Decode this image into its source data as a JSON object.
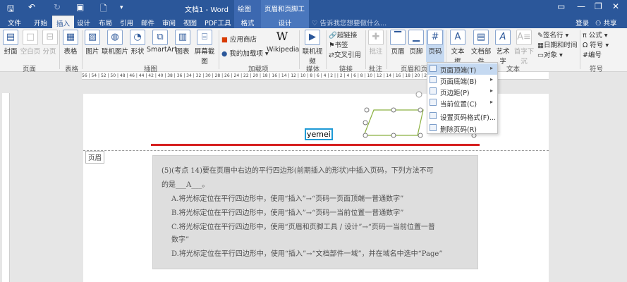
{
  "app": {
    "title": "文档1 - Word",
    "context_groups": [
      "绘图工具",
      "页眉和页脚工具"
    ],
    "login": "登录",
    "share": "共享"
  },
  "tabs": [
    "文件",
    "开始",
    "插入",
    "设计",
    "布局",
    "引用",
    "邮件",
    "审阅",
    "视图",
    "PDF工具",
    "格式",
    "设计"
  ],
  "active_tab": "插入",
  "tellme": "告诉我您想要做什么...",
  "ribbon": {
    "buttons": [
      "封面",
      "空白页",
      "分页",
      "表格",
      "图片",
      "联机图片",
      "形状",
      "SmartArt",
      "图表",
      "屏幕截图",
      "Wikipedia",
      "联机视频",
      "批注",
      "页眉",
      "页脚",
      "页码",
      "文本框",
      "文档部件",
      "艺术字",
      "首字下沉"
    ],
    "addins": [
      "应用商店",
      "我的加载项"
    ],
    "links": [
      "超链接",
      "书签",
      "交叉引用"
    ],
    "text_right": [
      "签名行",
      "日期和时间",
      "对象"
    ],
    "symbols": [
      "公式",
      "符号",
      "编号"
    ],
    "groups": [
      "页面",
      "表格",
      "插图",
      "加载项",
      "媒体",
      "链接",
      "批注",
      "页眉和页",
      "文本",
      "符号"
    ]
  },
  "ruler_text": "56 | 54 | 52 | 50 | 48 | 46 | 44 | 42 | 40 | 38 | 36 | 34 | 32 | 30 | 28 | 26 | 24 | 22 | 20 | 18 | 16 | 14 | 12 | 10 | 8 | 6 | 4 | 2 | | 2 | 4 | 6 | 8 | 10 | 12 | 14 | 16 | 18 | 20 | 22 | 24 | 26 | 28 | 30 | 32 | 34 | 36",
  "menu": {
    "items": [
      "页面顶端(T)",
      "页面底端(B)",
      "页边距(P)",
      "当前位置(C)",
      "设置页码格式(F)...",
      "删除页码(R)"
    ]
  },
  "document": {
    "header_text": "yemei",
    "header_label": "页眉",
    "photo_lines": [
      "(5)(考点 14)要在页眉中右边的平行四边形(前期插入的形状)中插入页码，下列方法不可",
      "的是___A___。",
      "A.将光标定位在平行四边形中，使用“插入”→“页码一页面顶端一普通数字”",
      "B.将光标定位在平行四边形中，使用“插入”→“页码一当前位置一普通数字”",
      "C.将光标定位在平行四边形中，使用“页眉和页脚工具 / 设计”→“页码一当前位置一普",
      "数字”",
      "D.将光标定位在平行四边形中，使用“插入”→“文档部件一域”，并在域名中选中“Page”"
    ]
  },
  "colors": {
    "accent": "#2b579a",
    "red_line": "#d61f1f",
    "highlight": "#c5d9f1",
    "selection_border": "#1e9ad6"
  }
}
